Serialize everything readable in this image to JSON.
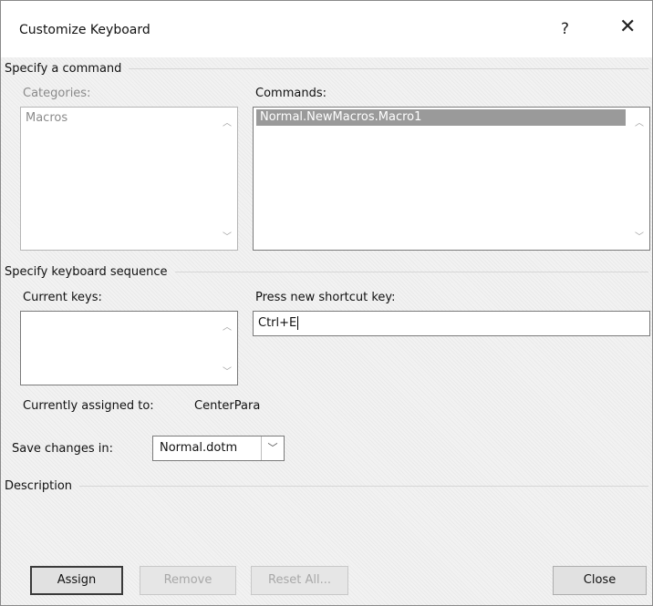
{
  "window": {
    "title": "Customize Keyboard",
    "help": "?",
    "close": "✕"
  },
  "specify_command": {
    "heading": "Specify a command",
    "categories_label": "Categories:",
    "categories": [
      "Macros"
    ],
    "commands_label": "Commands:",
    "commands": [
      "Normal.NewMacros.Macro1"
    ],
    "selected_command": "Normal.NewMacros.Macro1"
  },
  "keyboard_sequence": {
    "heading": "Specify keyboard sequence",
    "current_keys_label": "Current keys:",
    "current_keys": [],
    "new_shortcut_label": "Press new shortcut key:",
    "new_shortcut_value": "Ctrl+E",
    "currently_assigned_label": "Currently assigned to:",
    "currently_assigned_value": "CenterPara"
  },
  "save_changes": {
    "label": "Save changes in:",
    "value": "Normal.dotm"
  },
  "description": {
    "heading": "Description"
  },
  "buttons": {
    "assign": "Assign",
    "remove": "Remove",
    "reset_all": "Reset All...",
    "close": "Close"
  }
}
